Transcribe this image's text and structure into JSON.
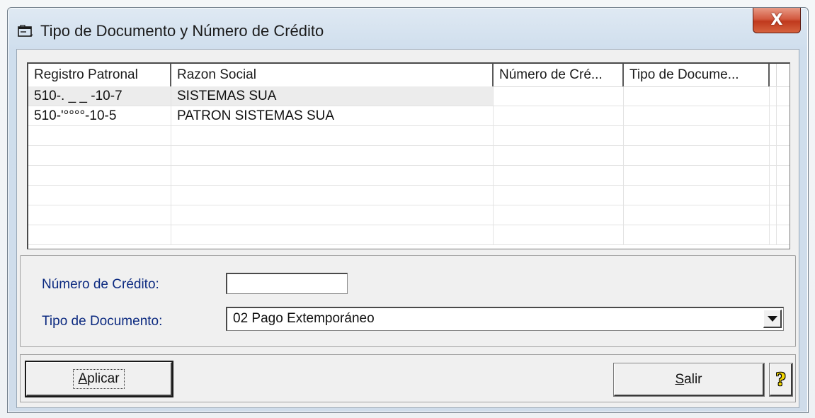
{
  "window": {
    "title": "Tipo de Documento y Número de Crédito",
    "close_label": "X"
  },
  "list": {
    "columns": [
      "Registro Patronal",
      "Razon Social",
      "Número de Cré...",
      "Tipo de Docume..."
    ],
    "rows": [
      {
        "registro": "510-. _ _ -10-7",
        "razon": "SISTEMAS SUA",
        "numero": "",
        "tipo": ""
      },
      {
        "registro": "510-'°°°°-10-5",
        "razon": "PATRON SISTEMAS SUA",
        "numero": "",
        "tipo": ""
      }
    ]
  },
  "form": {
    "numero_label": "Número de Crédito:",
    "numero_value": "",
    "tipo_label": "Tipo de Documento:",
    "tipo_value": "02 Pago Extemporáneo"
  },
  "buttons": {
    "apply_first": "A",
    "apply_rest": "plicar",
    "exit_first": "S",
    "exit_rest": "alir",
    "help": "?"
  },
  "colors": {
    "label_text": "#0c2a80",
    "close_button": "#c0391d"
  }
}
